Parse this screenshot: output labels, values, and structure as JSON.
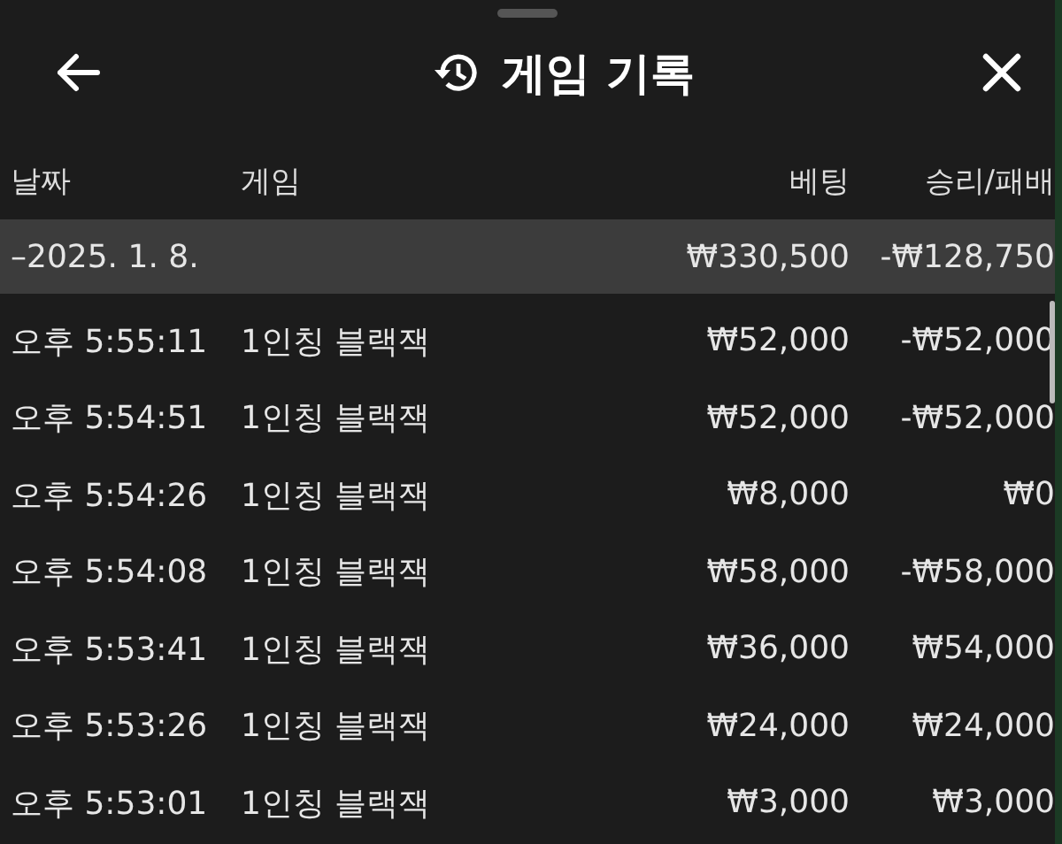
{
  "header": {
    "title": "게임 기록"
  },
  "table": {
    "columns": [
      "날짜",
      "게임",
      "베팅",
      "승리/패배"
    ],
    "group": {
      "date": "–2025. 1. 8.",
      "bet": "₩330,500",
      "result": "-₩128,750"
    },
    "rows": [
      {
        "time": "오후 5:55:11",
        "game": "1인칭 블랙잭",
        "bet": "₩52,000",
        "result": "-₩52,000"
      },
      {
        "time": "오후 5:54:51",
        "game": "1인칭 블랙잭",
        "bet": "₩52,000",
        "result": "-₩52,000"
      },
      {
        "time": "오후 5:54:26",
        "game": "1인칭 블랙잭",
        "bet": "₩8,000",
        "result": "₩0"
      },
      {
        "time": "오후 5:54:08",
        "game": "1인칭 블랙잭",
        "bet": "₩58,000",
        "result": "-₩58,000"
      },
      {
        "time": "오후 5:53:41",
        "game": "1인칭 블랙잭",
        "bet": "₩36,000",
        "result": "₩54,000"
      },
      {
        "time": "오후 5:53:26",
        "game": "1인칭 블랙잭",
        "bet": "₩24,000",
        "result": "₩24,000"
      },
      {
        "time": "오후 5:53:01",
        "game": "1인칭 블랙잭",
        "bet": "₩3,000",
        "result": "₩3,000"
      }
    ]
  }
}
